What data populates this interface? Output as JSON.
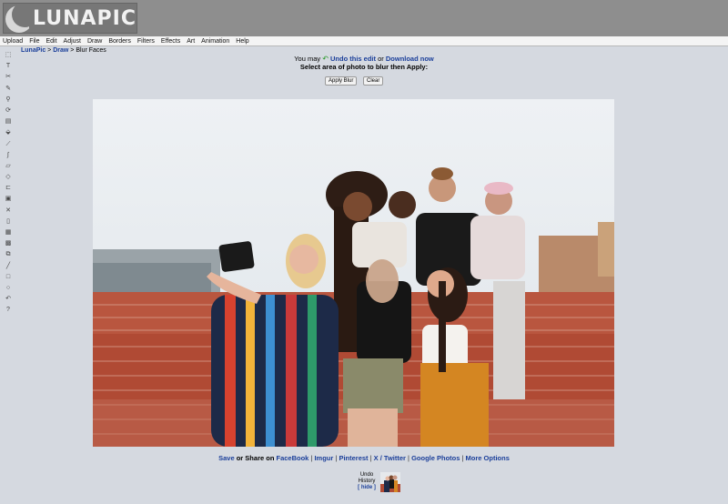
{
  "app": {
    "logo_text": "LUNAPIC"
  },
  "menu": [
    "Upload",
    "File",
    "Edit",
    "Adjust",
    "Draw",
    "Borders",
    "Filters",
    "Effects",
    "Art",
    "Animation",
    "Help"
  ],
  "toolbar": [
    {
      "name": "marquee-select-icon",
      "glyph": "⬚"
    },
    {
      "name": "text-tool-icon",
      "glyph": "T"
    },
    {
      "name": "scissors-icon",
      "glyph": "✂"
    },
    {
      "name": "pencil-icon",
      "glyph": "✎"
    },
    {
      "name": "zoom-icon",
      "glyph": "⚲"
    },
    {
      "name": "rotate-icon",
      "glyph": "⟳"
    },
    {
      "name": "crop-icon",
      "glyph": "▤"
    },
    {
      "name": "paint-bucket-icon",
      "glyph": "⬙"
    },
    {
      "name": "eyedropper-icon",
      "glyph": "⟋"
    },
    {
      "name": "brush-icon",
      "glyph": "∫"
    },
    {
      "name": "open-folder-icon",
      "glyph": "▱"
    },
    {
      "name": "eraser-icon",
      "glyph": "◇"
    },
    {
      "name": "open-file-icon",
      "glyph": "⊏"
    },
    {
      "name": "save-disk-icon",
      "glyph": "▣"
    },
    {
      "name": "close-x-icon",
      "glyph": "✕"
    },
    {
      "name": "new-page-icon",
      "glyph": "▯"
    },
    {
      "name": "print-icon",
      "glyph": "▦"
    },
    {
      "name": "layers-icon",
      "glyph": "▩"
    },
    {
      "name": "copy-icon",
      "glyph": "⧉"
    },
    {
      "name": "line-tool-icon",
      "glyph": "╱"
    },
    {
      "name": "rectangle-tool-icon",
      "glyph": "□"
    },
    {
      "name": "ellipse-tool-icon",
      "glyph": "○"
    },
    {
      "name": "undo-icon",
      "glyph": "↶"
    },
    {
      "name": "help-icon",
      "glyph": "?"
    }
  ],
  "breadcrumb": {
    "home": "LunaPic",
    "sep": " > ",
    "section": "Draw",
    "current": "Blur Faces"
  },
  "notice": {
    "you_may": "You may ",
    "undo_icon": "↶",
    "undo_link": "Undo this edit",
    "or": " or ",
    "download_link": "Download now",
    "instruction": "Select area of photo to blur then Apply:"
  },
  "buttons": {
    "apply_blur": "Apply Blur",
    "clear": "Clear"
  },
  "share": {
    "save": "Save",
    "or_share_on": " or Share on ",
    "facebook": "FaceBook",
    "imgur": "Imgur",
    "pinterest": "Pinterest",
    "x_twitter": "X / Twitter",
    "google_photos": "Google Photos",
    "more_options": "More Options",
    "separator": " | "
  },
  "history": {
    "line1": "Undo",
    "line2": "History",
    "hide": "[ hide ]"
  },
  "colors": {
    "header": "#8e8e8e",
    "background": "#d5d9e0",
    "link": "#1b3f9a"
  }
}
